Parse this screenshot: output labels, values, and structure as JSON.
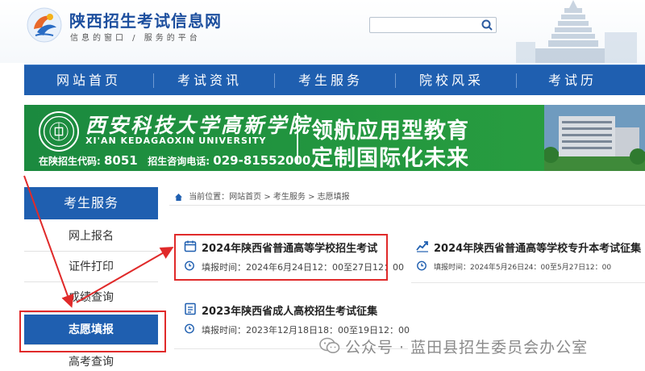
{
  "header": {
    "title": "陕西招生考试信息网",
    "slogan": "信息的窗口 / 服务的平台",
    "search_placeholder": ""
  },
  "nav": {
    "items": [
      "网站首页",
      "考试资讯",
      "考生服务",
      "院校风采",
      "考试历"
    ]
  },
  "banner": {
    "university_cn": "西安科技大学高新学院",
    "university_en": "XI'AN KEDAGAOXIN UNIVERSITY",
    "code_label": "在陕招生代码:",
    "code": "8051",
    "phone_label": "招生咨询电话:",
    "phone": "029-81552000",
    "slogan_line1": "领航应用型教育",
    "slogan_line2": "定制国际化未来"
  },
  "sidebar": {
    "heading": "考生服务",
    "items": [
      "网上报名",
      "证件打印",
      "成绩查询",
      "志愿填报",
      "高考查询"
    ],
    "active_index": 3
  },
  "breadcrumb": {
    "prefix": "当前位置：",
    "path": "网站首页 > 考生服务 > 志愿填报"
  },
  "cards": [
    {
      "title": "2024年陕西省普通高等学校招生考试",
      "time": "填报时间：2024年6月24日12：00至27日12：00"
    },
    {
      "title": "2024年陕西省普通高等学校专升本考试征集",
      "time": "填报时间：2024年5月26日24：00至5月27日12：00"
    },
    {
      "title": "2023年陕西省成人高校招生考试征集",
      "time": "填报时间：2023年12月18日18：00至19日12：00"
    }
  ],
  "watermark": {
    "text": "公众号 · 蓝田县招生委员会办公室"
  },
  "colors": {
    "nav_blue": "#1f5fb0",
    "banner_green": "#23973f",
    "highlight_red": "#e02a2a"
  }
}
